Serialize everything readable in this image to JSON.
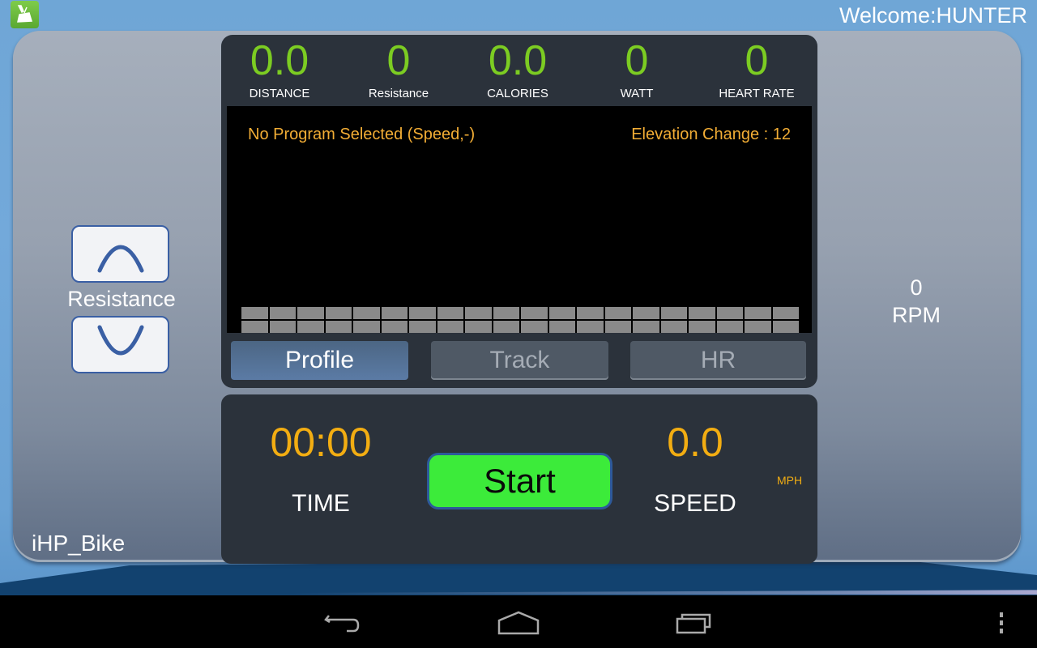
{
  "header": {
    "app_icon": "exercise-bike-icon",
    "welcome_text": "Welcome:HUNTER"
  },
  "stats": [
    {
      "value": "0.0",
      "label": "DISTANCE"
    },
    {
      "value": "0",
      "label": "Resistance"
    },
    {
      "value": "0.0",
      "label": "CALORIES"
    },
    {
      "value": "0",
      "label": "WATT"
    },
    {
      "value": "0",
      "label": "HEART RATE"
    }
  ],
  "graph": {
    "program_text": "No Program Selected (Speed,-)",
    "elevation_text": "Elevation Change : 12",
    "segment_count": 20,
    "segment_levels": [
      2,
      2,
      2,
      2,
      2,
      2,
      2,
      2,
      2,
      2,
      2,
      2,
      2,
      2,
      2,
      2,
      2,
      2,
      2,
      2
    ]
  },
  "tabs": [
    {
      "label": "Profile",
      "active": true
    },
    {
      "label": "Track",
      "active": false
    },
    {
      "label": "HR",
      "active": false
    }
  ],
  "workout": {
    "time_value": "00:00",
    "time_label": "TIME",
    "start_label": "Start",
    "speed_value": "0.0",
    "speed_label": "SPEED",
    "speed_unit": "MPH"
  },
  "resistance_control": {
    "label": "Resistance",
    "up_icon": "chevron-up-icon",
    "down_icon": "chevron-down-icon"
  },
  "rpm": {
    "value": "0",
    "unit": "RPM"
  },
  "device_name": "iHP_Bike",
  "navbar": {
    "buttons": [
      "back-icon",
      "home-icon",
      "recent-apps-icon",
      "overflow-menu-icon"
    ]
  },
  "colors": {
    "stat_green": "#7ccc22",
    "accent_orange": "#f2ad12",
    "start_green": "#3ceb3a",
    "tab_active": "#5b7ba5"
  }
}
